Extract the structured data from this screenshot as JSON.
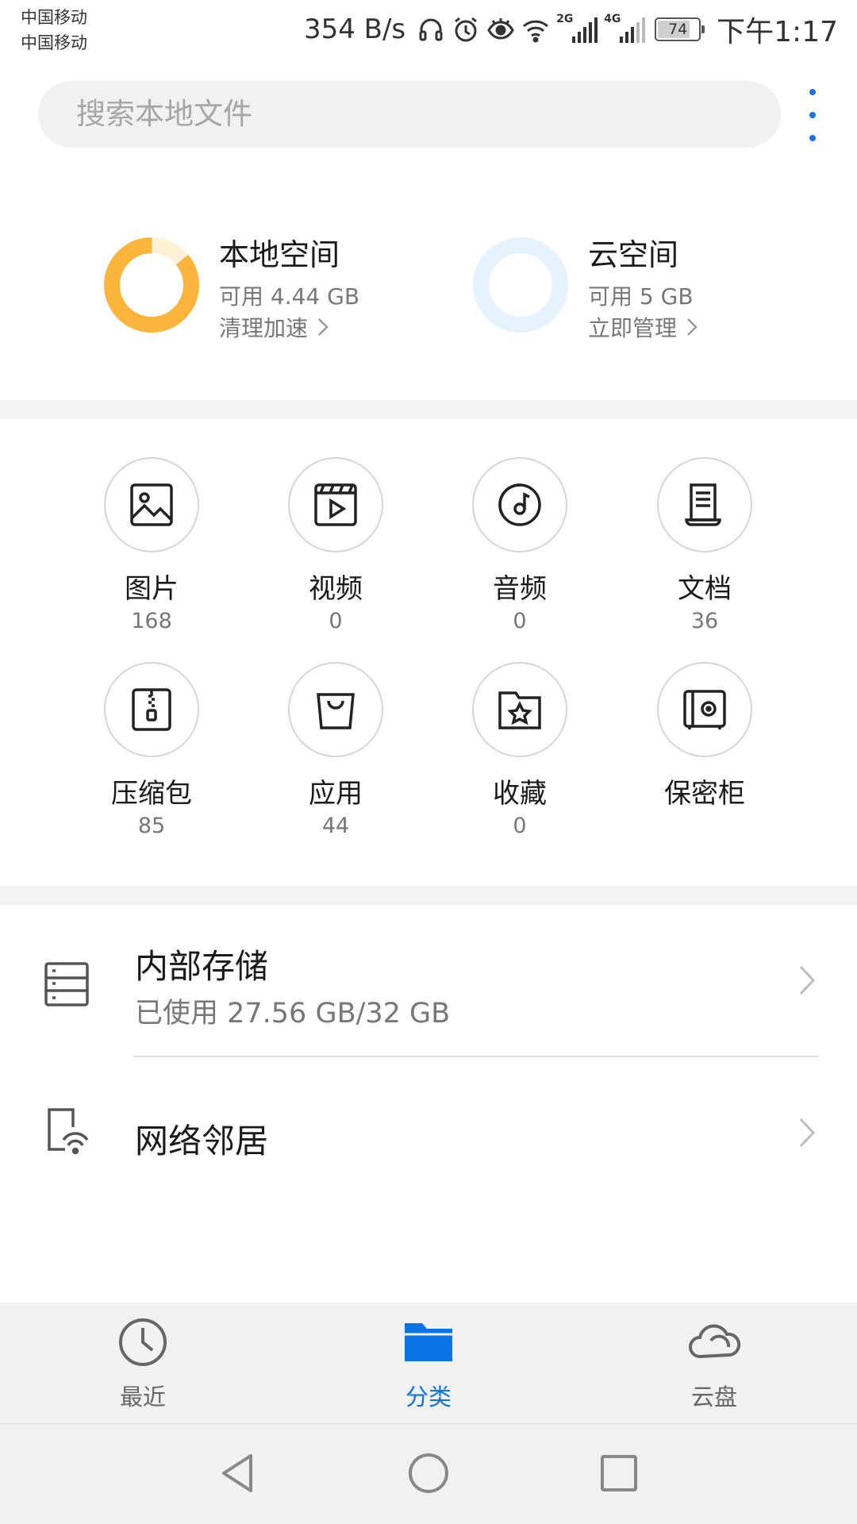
{
  "status_bar": {
    "carrier_1": "中国移动",
    "carrier_2": "中国移动",
    "net_speed": "354 B/s",
    "signal_1_type": "2G",
    "signal_2_type": "4G",
    "battery": "74",
    "time": "下午1:17",
    "icons": [
      "headset-icon",
      "alarm-icon",
      "eye-icon",
      "wifi-icon",
      "signal-icon",
      "battery-icon"
    ]
  },
  "search": {
    "placeholder": "搜索本地文件"
  },
  "storage": {
    "local": {
      "title": "本地空间",
      "available": "可用 4.44 GB",
      "action": "清理加速",
      "used_fraction": 0.86,
      "color": "#fbb53d",
      "track_color": "#fdf1d6"
    },
    "cloud": {
      "title": "云空间",
      "available": "可用 5 GB",
      "action": "立即管理",
      "used_fraction": 0.0,
      "track_color": "#e6f2fd"
    }
  },
  "categories": [
    {
      "label": "图片",
      "count": "168",
      "icon": "image-icon"
    },
    {
      "label": "视频",
      "count": "0",
      "icon": "video-icon"
    },
    {
      "label": "音频",
      "count": "0",
      "icon": "audio-icon"
    },
    {
      "label": "文档",
      "count": "36",
      "icon": "document-icon"
    },
    {
      "label": "压缩包",
      "count": "85",
      "icon": "archive-icon"
    },
    {
      "label": "应用",
      "count": "44",
      "icon": "app-bag-icon"
    },
    {
      "label": "收藏",
      "count": "0",
      "icon": "favorite-folder-icon"
    },
    {
      "label": "保密柜",
      "count": "",
      "icon": "safe-icon"
    }
  ],
  "locations": {
    "internal": {
      "title": "内部存储",
      "subtitle": "已使用 27.56 GB/32 GB"
    },
    "network": {
      "title": "网络邻居"
    }
  },
  "tabs": [
    {
      "label": "最近",
      "icon": "clock-icon",
      "active": false
    },
    {
      "label": "分类",
      "icon": "folder-icon",
      "active": true
    },
    {
      "label": "云盘",
      "icon": "cloud-icon",
      "active": false
    }
  ],
  "colors": {
    "accent": "#0a74e6",
    "local_ring": "#fbb53d",
    "cloud_ring": "#e6f2fd"
  }
}
